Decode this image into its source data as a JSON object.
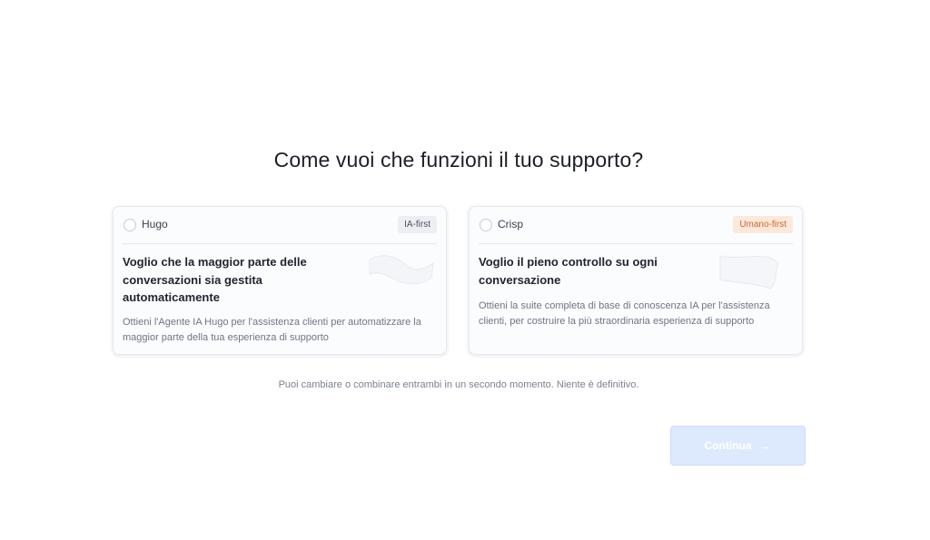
{
  "page": {
    "title": "Come vuoi che funzioni il tuo supporto?",
    "note": "Puoi cambiare o combinare entrambi in un secondo momento. Niente è definitivo."
  },
  "options": [
    {
      "name": "Hugo",
      "badge": "IA-first",
      "heading": "Voglio che la maggior parte delle conversazioni sia gestita automaticamente",
      "description": "Ottieni l'Agente IA Hugo per l'assistenza clienti per automatizzare la maggior parte della tua esperienza di supporto"
    },
    {
      "name": "Crisp",
      "badge": "Umano-first",
      "heading": "Voglio il pieno controllo su ogni conversazione",
      "description": "Ottieni la suite completa di base di conoscenza IA per l'assistenza clienti, per costruire la più straordinaria esperienza di supporto"
    }
  ],
  "continue_button": {
    "label": "Continua",
    "arrow": "→"
  },
  "colors": {
    "button_bg": "#dde9fd",
    "badge_human_bg": "#fde8dc",
    "badge_human_text": "#d2662a",
    "badge_ai_bg": "#eceef3"
  }
}
